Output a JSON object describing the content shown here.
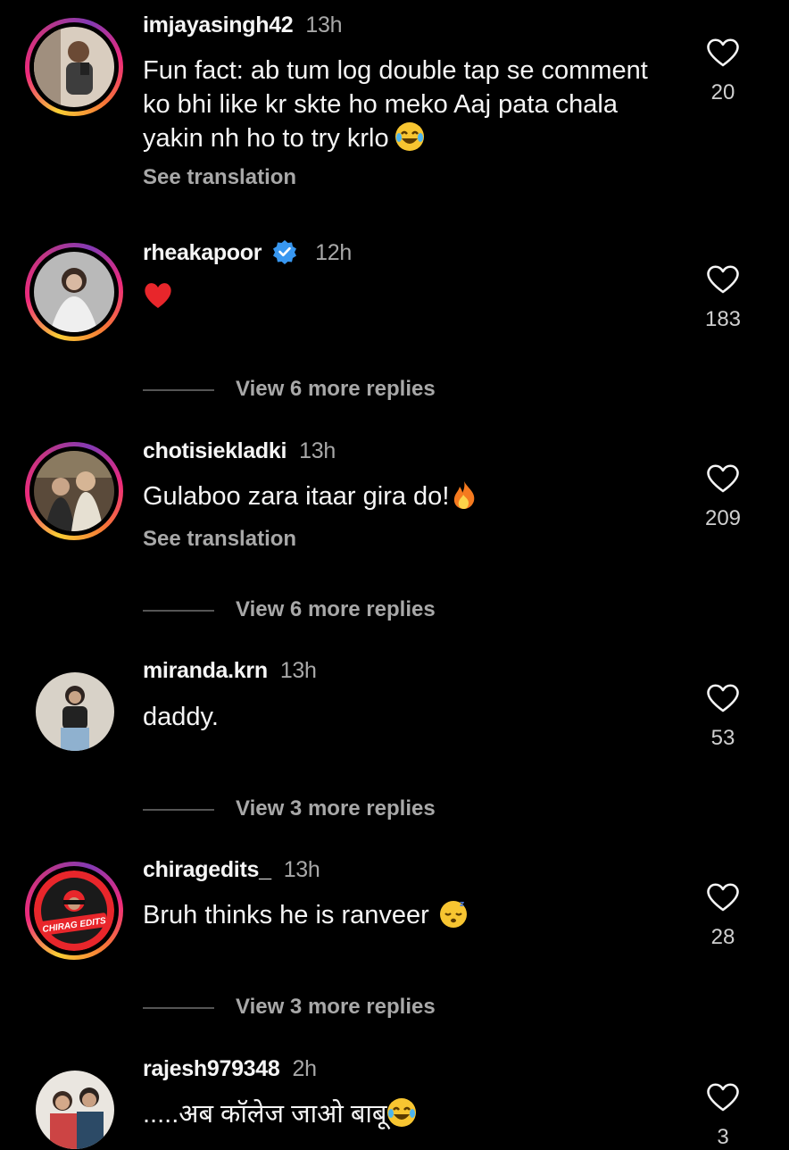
{
  "comments": [
    {
      "username": "imjayasingh42",
      "time": "13h",
      "text": "Fun fact:  ab tum log double tap se comment ko bhi like kr skte ho meko Aaj pata chala yakin nh ho to try krlo",
      "emoji": "laughing-tears-emoji",
      "see_translation": "See translation",
      "likes": "20"
    },
    {
      "username": "rheakapoor",
      "verified": true,
      "time": "12h",
      "text": "",
      "emoji": "red-heart-emoji",
      "likes": "183",
      "replies": "View 6 more replies"
    },
    {
      "username": "chotisiekladki",
      "time": "13h",
      "text": "Gulaboo zara itaar gira do!",
      "emoji": "fire-emoji",
      "see_translation": "See translation",
      "likes": "209",
      "replies": "View 6 more replies"
    },
    {
      "username": "miranda.krn",
      "time": "13h",
      "text": "daddy.",
      "likes": "53",
      "replies": "View 3 more replies"
    },
    {
      "username": "chiragedits_",
      "time": "13h",
      "text": "Bruh thinks he is ranveer",
      "emoji": "sleeping-face-emoji",
      "avatar_text": "CHIRAG EDITS",
      "likes": "28",
      "replies": "View 3 more replies"
    },
    {
      "username": "rajesh979348",
      "time": "2h",
      "text": ".....अब कॉलेज जाओ बाबू",
      "emoji": "laughing-tears-emoji",
      "likes": "3"
    }
  ],
  "colors": {
    "background": "#000000",
    "text": "#f5f5f5",
    "secondary": "#a8a8a8",
    "verified": "#3897f0",
    "heart": "#e8262b"
  }
}
